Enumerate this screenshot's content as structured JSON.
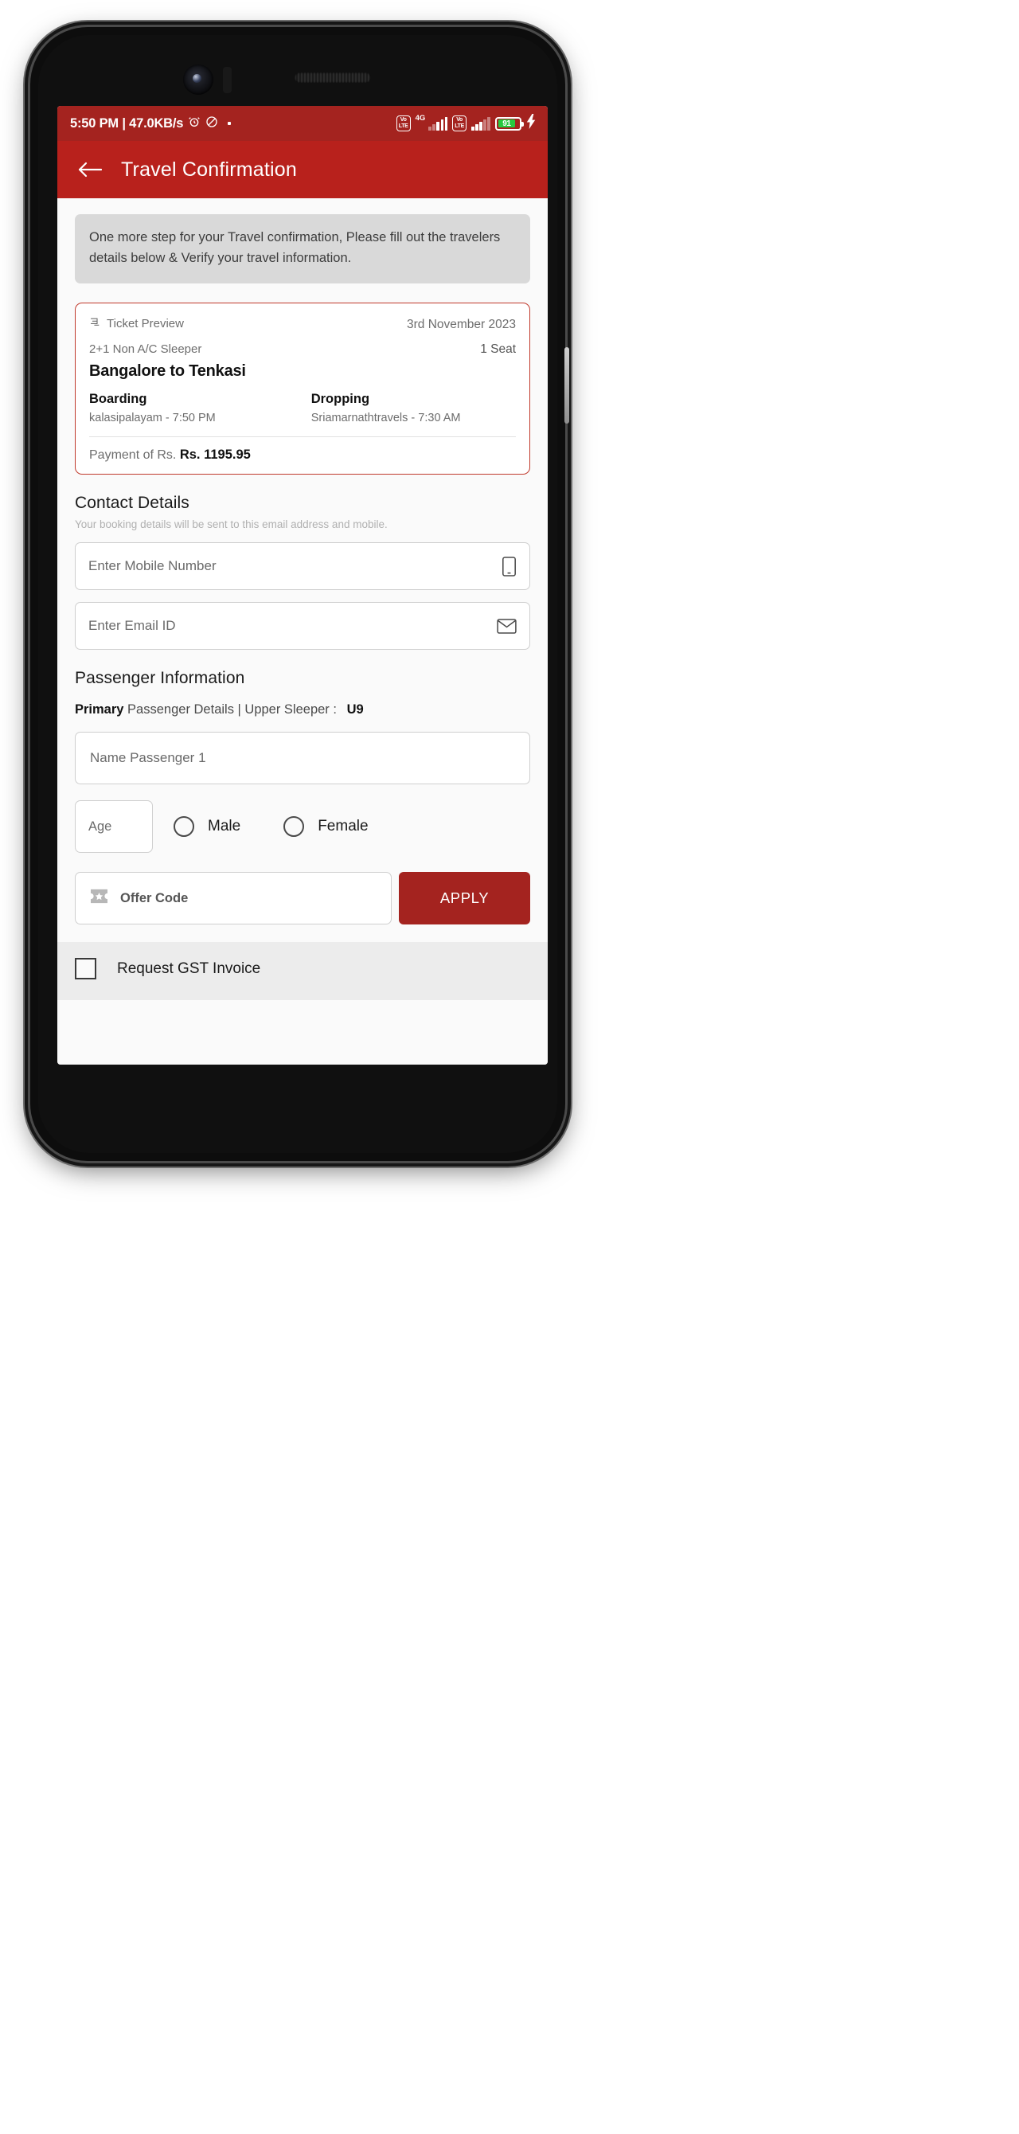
{
  "status_bar": {
    "time_and_speed": "5:50 PM | 47.0KB/s",
    "alarm_icon": "alarm-clock-icon",
    "dnd_icon": "do-not-disturb-icon",
    "dot": "·",
    "volte_1": "VoLTE",
    "network_4g": "4G",
    "volte_2": "VoLTE",
    "battery_percent": "91",
    "charging_icon": "charging-bolt-icon",
    "bg_color": "#a4231f"
  },
  "app_bar": {
    "back_icon": "back-arrow-icon",
    "title": "Travel Confirmation",
    "bg_color": "#b8211c"
  },
  "notice": {
    "text": "One more step for your Travel confirmation, Please fill out the travelers details below & Verify your travel information."
  },
  "ticket": {
    "preview_icon": "bus-seat-icon",
    "preview_label": "Ticket Preview",
    "date": "3rd November 2023",
    "bus_type": "2+1 Non A/C Sleeper",
    "seat_count": "1 Seat",
    "route": "Bangalore to Tenkasi",
    "boarding_label": "Boarding",
    "boarding_value": "kalasipalayam - 7:50 PM",
    "dropping_label": "Dropping",
    "dropping_value": "Sriamarnathtravels - 7:30 AM",
    "payment_prefix": "Payment of Rs.",
    "payment_amount": "Rs. 1195.95",
    "border_color": "#c0392b"
  },
  "contact": {
    "heading": "Contact Details",
    "subtitle": "Your booking details will be sent to this email address and mobile.",
    "mobile_placeholder": "Enter Mobile Number",
    "mobile_value": "",
    "mobile_icon": "mobile-phone-icon",
    "email_placeholder": "Enter Email ID",
    "email_value": "",
    "email_icon": "envelope-icon"
  },
  "passenger": {
    "heading": "Passenger Information",
    "primary_bold": "Primary",
    "primary_rest": " Passenger Details | Upper Sleeper : ",
    "seat_no": "U9",
    "name_placeholder": "Name Passenger 1",
    "name_value": "",
    "age_placeholder": "Age",
    "age_value": "",
    "male_label": "Male",
    "female_label": "Female"
  },
  "offer": {
    "icon": "ticket-star-icon",
    "placeholder": "Offer Code",
    "value": "",
    "apply_label": "APPLY",
    "apply_color": "#a4231f"
  },
  "gst": {
    "checkbox_state": "unchecked",
    "label": "Request GST Invoice"
  }
}
